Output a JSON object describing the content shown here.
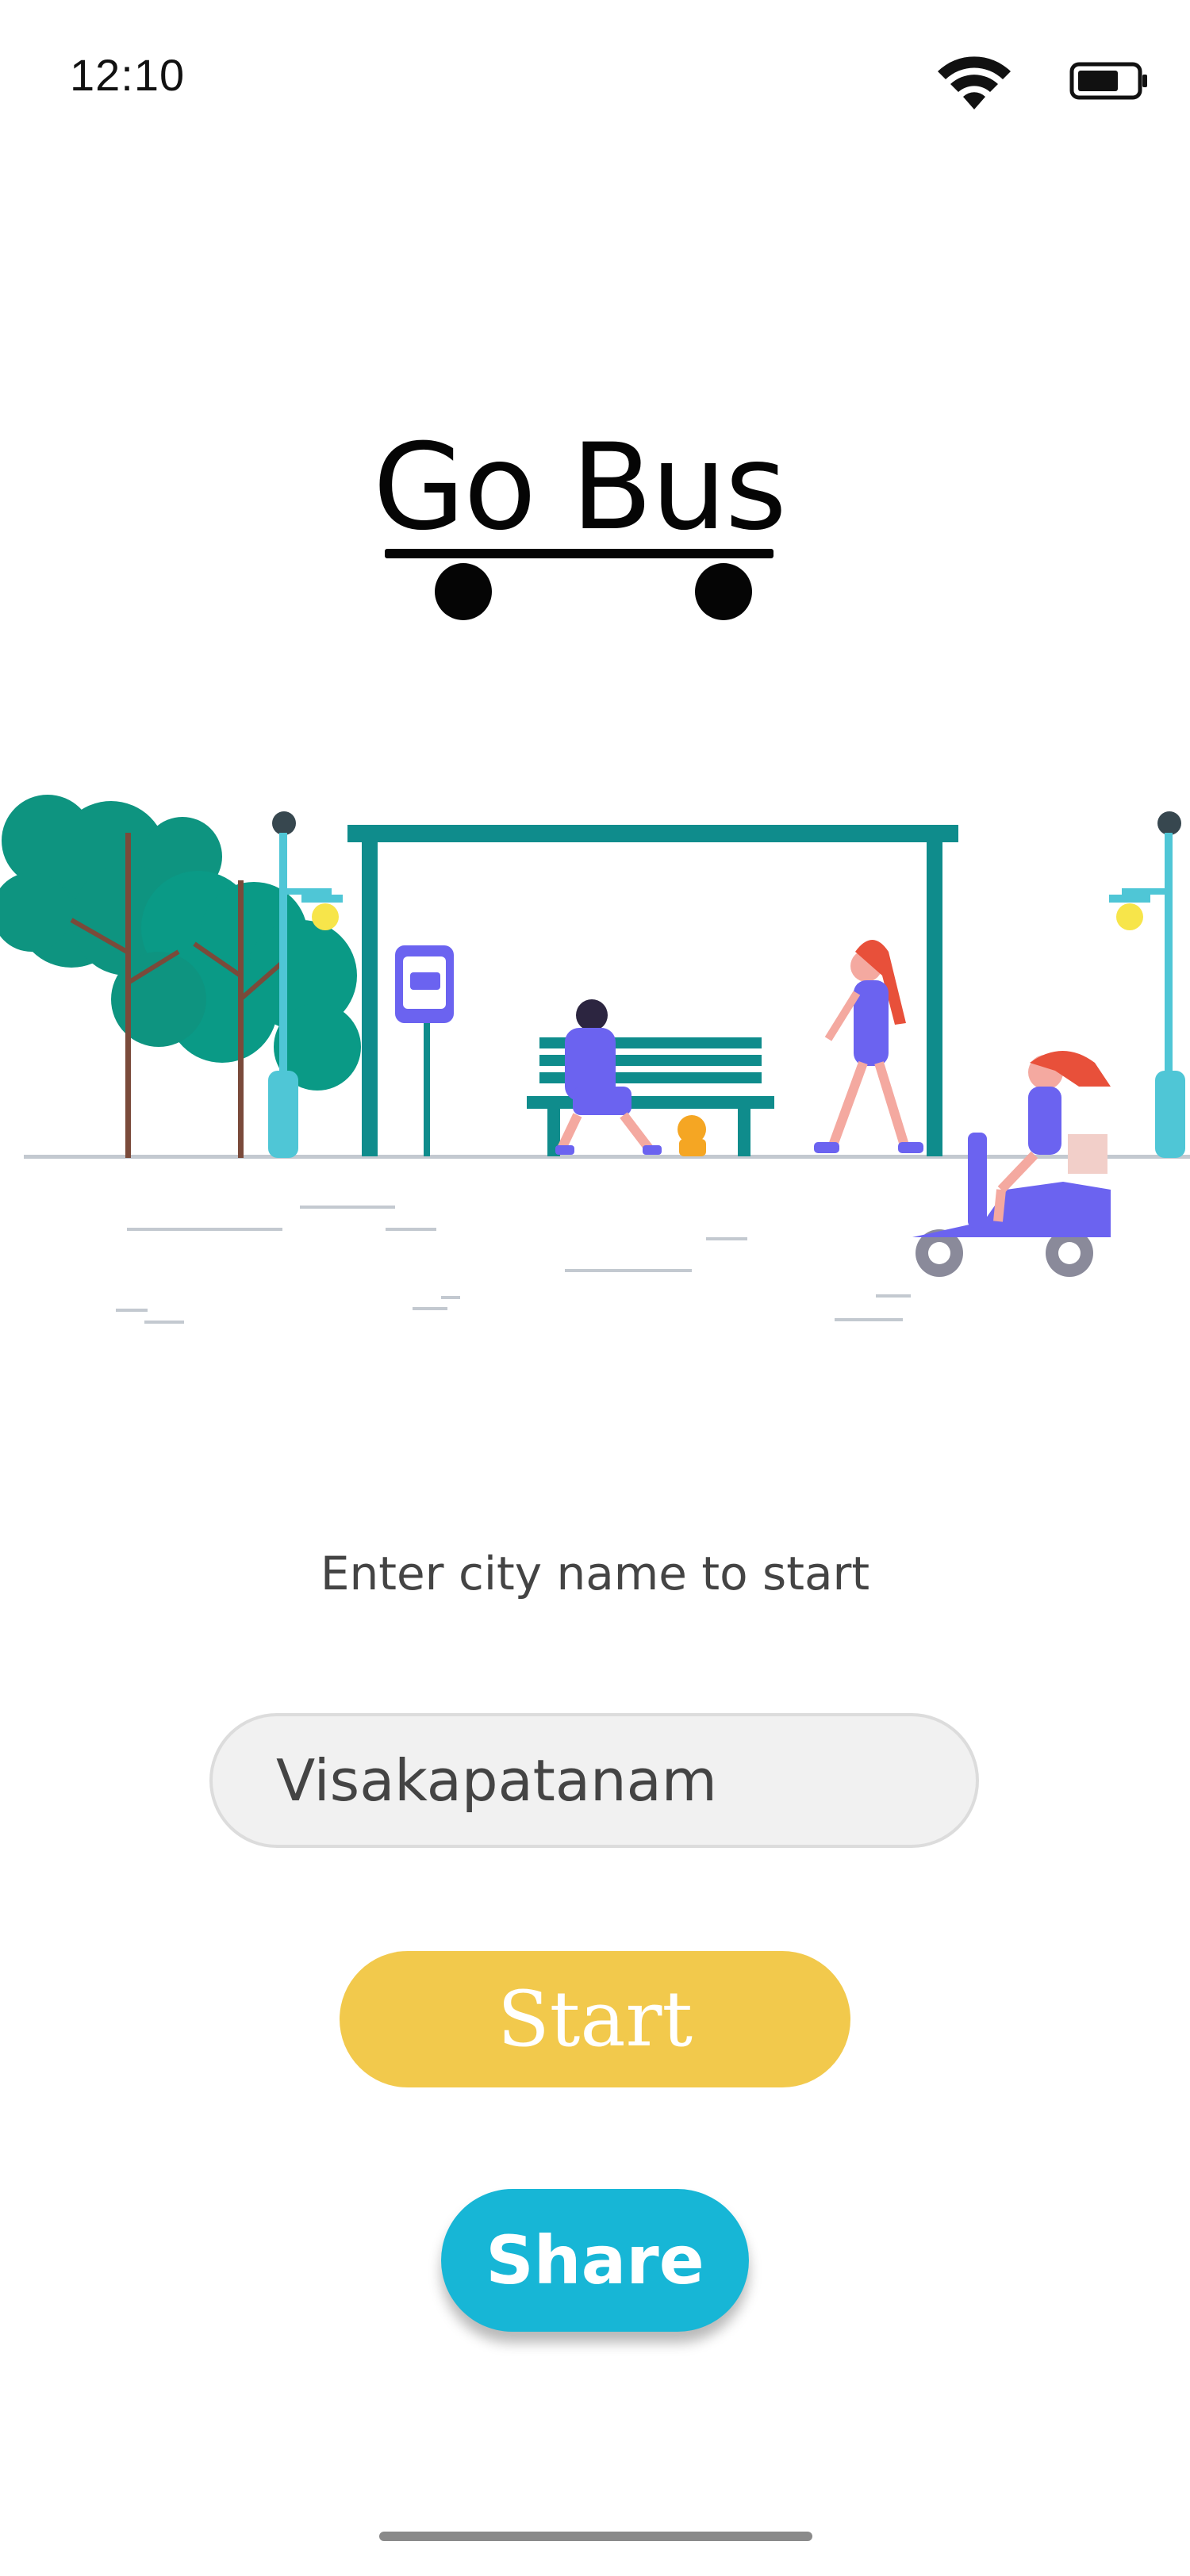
{
  "status_bar": {
    "time": "12:10",
    "icons": [
      "wifi-icon",
      "battery-icon"
    ]
  },
  "logo": {
    "text": "Go Bus"
  },
  "illustration": {
    "name": "bus-stop-illustration",
    "colors": {
      "tree": "#0e9480",
      "shelter": "#0f8c8c",
      "person": "#6b63f0",
      "hair_red": "#e8503a",
      "lamp": "#4fc6d6",
      "lamp_light": "#f7e54a",
      "ground": "#c3c9d0"
    }
  },
  "form": {
    "prompt": "Enter city name to start",
    "city_input": {
      "value": "Visakapatanam",
      "placeholder": ""
    },
    "start_label": "Start",
    "share_label": "Share"
  },
  "colors": {
    "start_button": "#f2c94c",
    "share_button": "#17b6d6",
    "input_background": "#f1f1f1",
    "text_primary": "#444444"
  }
}
